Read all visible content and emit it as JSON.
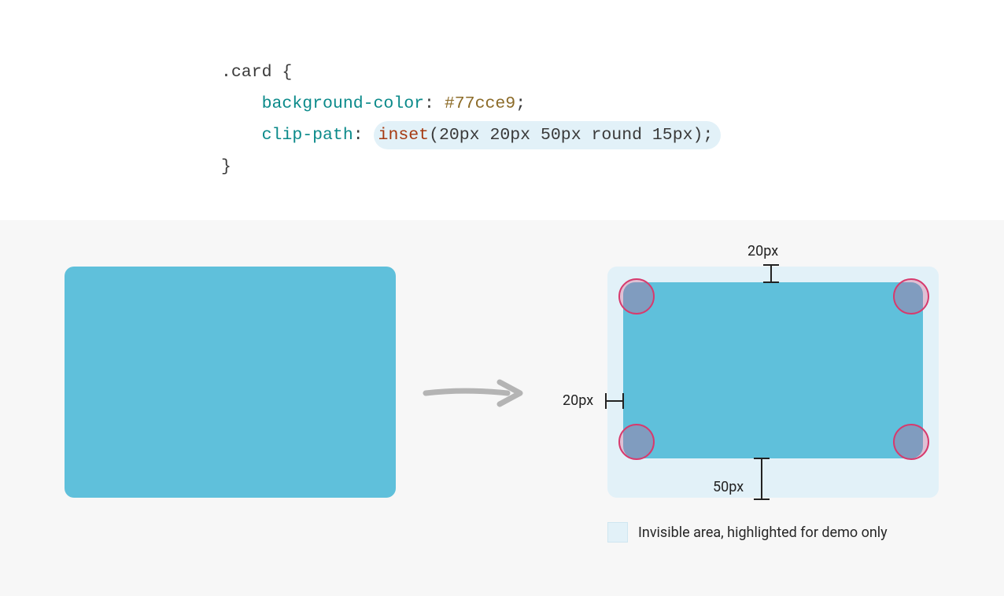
{
  "code": {
    "selector": ".card",
    "open_brace": " {",
    "close_brace": "}",
    "prop1_name": "background-color",
    "prop1_value": "#77cce9",
    "prop2_name": "clip-path",
    "prop2_fn": "inset",
    "prop2_args": "(20px 20px 50px round 15px)",
    "colon": ":",
    "semicolon": ";"
  },
  "diagram": {
    "card_color": "#5fc0db",
    "highlight_bg": "#e2f1f8",
    "top_label": "20px",
    "left_label": "20px",
    "bottom_label": "50px",
    "corner_radius_px": 15,
    "circle_color": "#d73a6d"
  },
  "legend": {
    "text": "Invisible area, highlighted for demo only"
  }
}
